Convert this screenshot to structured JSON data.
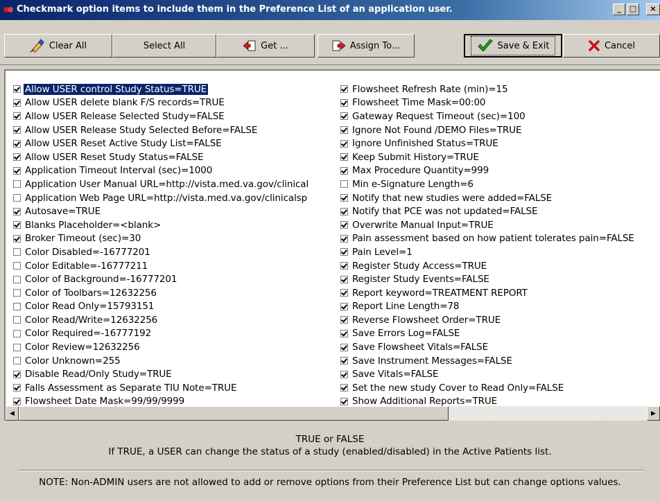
{
  "window": {
    "title": "Checkmark option items to include them in the Preference List of an application  user."
  },
  "toolbar": {
    "clear_all": "Clear All",
    "select_all": "Select All",
    "get": "Get ...",
    "assign_to": "Assign To...",
    "save_exit": "Save & Exit",
    "cancel": "Cancel"
  },
  "options_left": [
    {
      "label": "Allow USER control Study Status=TRUE",
      "checked": true,
      "selected": true
    },
    {
      "label": "Allow USER delete blank F/S records=TRUE",
      "checked": true
    },
    {
      "label": "Allow USER Release Selected Study=FALSE",
      "checked": true
    },
    {
      "label": "Allow USER Release Study Selected Before=FALSE",
      "checked": true
    },
    {
      "label": "Allow USER Reset Active Study List=FALSE",
      "checked": true
    },
    {
      "label": "Allow USER Reset Study Status=FALSE",
      "checked": true
    },
    {
      "label": "Application Timeout Interval (sec)=1000",
      "checked": true
    },
    {
      "label": "Application User Manual URL=http://vista.med.va.gov/clinical",
      "checked": false
    },
    {
      "label": "Application Web Page URL=http://vista.med.va.gov/clinicalsp",
      "checked": false
    },
    {
      "label": "Autosave=TRUE",
      "checked": true
    },
    {
      "label": "Blanks Placeholder=<blank>",
      "checked": true
    },
    {
      "label": "Broker Timeout (sec)=30",
      "checked": true
    },
    {
      "label": "Color Disabled=-16777201",
      "checked": false
    },
    {
      "label": "Color Editable=-16777211",
      "checked": false
    },
    {
      "label": "Color of Background=-16777201",
      "checked": false
    },
    {
      "label": "Color of Toolbars=12632256",
      "checked": false
    },
    {
      "label": "Color Read Only=15793151",
      "checked": false
    },
    {
      "label": "Color Read/Write=12632256",
      "checked": false
    },
    {
      "label": "Color Required=-16777192",
      "checked": false
    },
    {
      "label": "Color Review=12632256",
      "checked": false
    },
    {
      "label": "Color Unknown=255",
      "checked": false
    },
    {
      "label": "Disable Read/Only Study=TRUE",
      "checked": true
    },
    {
      "label": "Falls Assessment as Separate TIU Note=TRUE",
      "checked": true
    },
    {
      "label": "Flowsheet Date Mask=99/99/9999",
      "checked": true
    }
  ],
  "options_right": [
    {
      "label": "Flowsheet Refresh Rate (min)=15",
      "checked": true
    },
    {
      "label": "Flowsheet Time Mask=00:00",
      "checked": true
    },
    {
      "label": "Gateway Request Timeout (sec)=100",
      "checked": true
    },
    {
      "label": "Ignore Not Found /DEMO Files=TRUE",
      "checked": true
    },
    {
      "label": "Ignore Unfinished Status=TRUE",
      "checked": true
    },
    {
      "label": "Keep Submit History=TRUE",
      "checked": true
    },
    {
      "label": "Max Procedure Quantity=999",
      "checked": true
    },
    {
      "label": "Min e-Signature Length=6",
      "checked": false
    },
    {
      "label": "Notify that new studies were added=FALSE",
      "checked": true
    },
    {
      "label": "Notify that PCE was not updated=FALSE",
      "checked": true
    },
    {
      "label": "Overwrite Manual Input=TRUE",
      "checked": true
    },
    {
      "label": "Pain assessment based on how patient tolerates pain=FALSE",
      "checked": true
    },
    {
      "label": "Pain Level=1",
      "checked": true
    },
    {
      "label": "Register Study Access=TRUE",
      "checked": true
    },
    {
      "label": "Register Study Events=FALSE",
      "checked": true
    },
    {
      "label": "Report keyword=TREATMENT REPORT",
      "checked": true
    },
    {
      "label": "Report Line Length=78",
      "checked": true
    },
    {
      "label": "Reverse Flowsheet Order=TRUE",
      "checked": true
    },
    {
      "label": "Save Errors Log=FALSE",
      "checked": true
    },
    {
      "label": "Save Flowsheet Vitals=FALSE",
      "checked": true
    },
    {
      "label": "Save Instrument Messages=FALSE",
      "checked": true
    },
    {
      "label": "Save Vitals=FALSE",
      "checked": true
    },
    {
      "label": "Set the new study Cover to Read Only=FALSE",
      "checked": true
    },
    {
      "label": "Show Additional Reports=TRUE",
      "checked": true
    }
  ],
  "description": {
    "line1": "TRUE or FALSE",
    "line2": "If TRUE, a USER can change the status of a study (enabled/disabled) in the Active Patients list."
  },
  "note": "NOTE:  Non-ADMIN users are not allowed to add or remove options from their Preference List but can change options values."
}
